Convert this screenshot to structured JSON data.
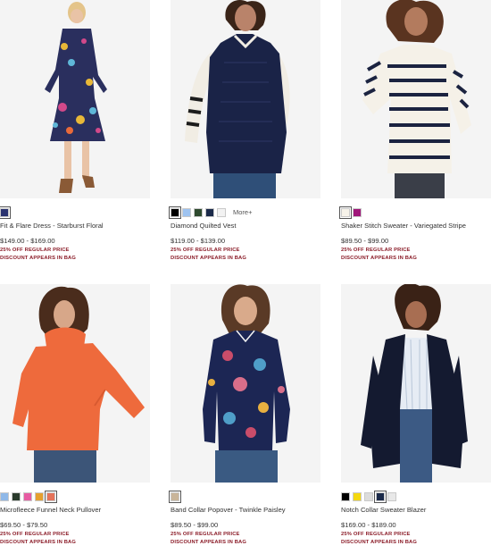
{
  "products": [
    {
      "name": "Fit & Flare Dress - Starburst Floral",
      "price": "$149.00 - $169.00",
      "promo_line1": "25% OFF REGULAR PRICE",
      "promo_line2": "DISCOUNT APPEARS IN BAG",
      "swatches": [
        "#2b3370"
      ],
      "more_label": ""
    },
    {
      "name": "Diamond Quilted Vest",
      "price": "$119.00 - $139.00",
      "promo_line1": "25% OFF REGULAR PRICE",
      "promo_line2": "DISCOUNT APPEARS IN BAG",
      "swatches": [
        "#000000",
        "#9ec3f0",
        "#2e4a2e",
        "#1b2a4a",
        "#f2f2f2"
      ],
      "more_label": "More+"
    },
    {
      "name": "Shaker Stitch Sweater - Variegated Stripe",
      "price": "$89.50 - $99.00",
      "promo_line1": "25% OFF REGULAR PRICE",
      "promo_line2": "DISCOUNT APPEARS IN BAG",
      "swatches": [
        "#f7f3ea",
        "#a0177a"
      ],
      "more_label": ""
    },
    {
      "name": "Microfleece Funnel Neck Pullover",
      "price": "$69.50 - $79.50",
      "promo_line1": "25% OFF REGULAR PRICE",
      "promo_line2": "DISCOUNT APPEARS IN BAG",
      "swatches": [
        "#8fb8e8",
        "#2a3b2c",
        "#e75ca3",
        "#e6a02e",
        "#e5735a"
      ],
      "more_label": ""
    },
    {
      "name": "Band Collar Popover - Twinkle Paisley",
      "price": "$89.50 - $99.00",
      "promo_line1": "25% OFF REGULAR PRICE",
      "promo_line2": "DISCOUNT APPEARS IN BAG",
      "swatches": [
        "#c9b59a"
      ],
      "more_label": ""
    },
    {
      "name": "Notch Collar Sweater Blazer",
      "price": "$169.00 - $189.00",
      "promo_line1": "25% OFF REGULAR PRICE",
      "promo_line2": "DISCOUNT APPEARS IN BAG",
      "swatches": [
        "#000000",
        "#f4d810",
        "#dcdcdc",
        "#1b2a4a",
        "#e8e8e8"
      ],
      "more_label": ""
    }
  ]
}
